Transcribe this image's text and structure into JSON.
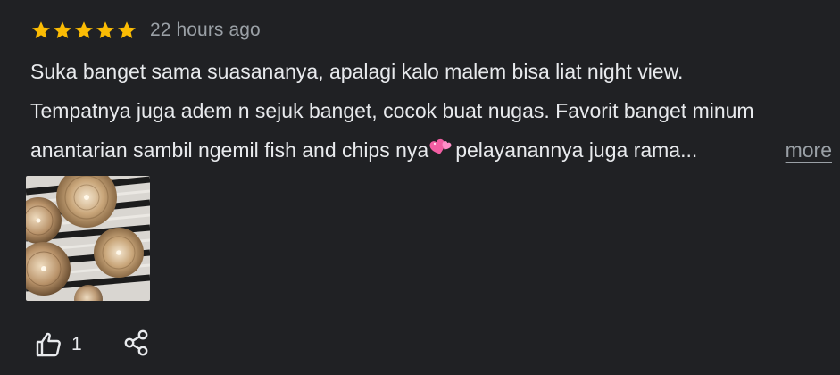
{
  "review": {
    "rating": 5,
    "rating_max": 5,
    "star_color": "#fbbc04",
    "time_ago": "22 hours ago",
    "text_line_1": "Suka banget sama suasananya, apalagi kalo malem bisa liat night view.",
    "text_line_2": "Tempatnya juga adem n sejuk banget, cocok buat nugas. Favorit banget minum",
    "text_line_3a": "anantarian sambil ngemil fish and chips nya",
    "text_line_3_emoji": "two-hearts-emoji",
    "text_line_3b": " pelayanannya juga rama...",
    "more_label": "more",
    "photo_icon": "review-photo-thumbnail",
    "like_icon": "thumbs-up-icon",
    "like_count": "1",
    "share_icon": "share-icon"
  },
  "colors": {
    "background": "#202124",
    "text_primary": "#e8eaed",
    "text_secondary": "#9aa0a6"
  }
}
